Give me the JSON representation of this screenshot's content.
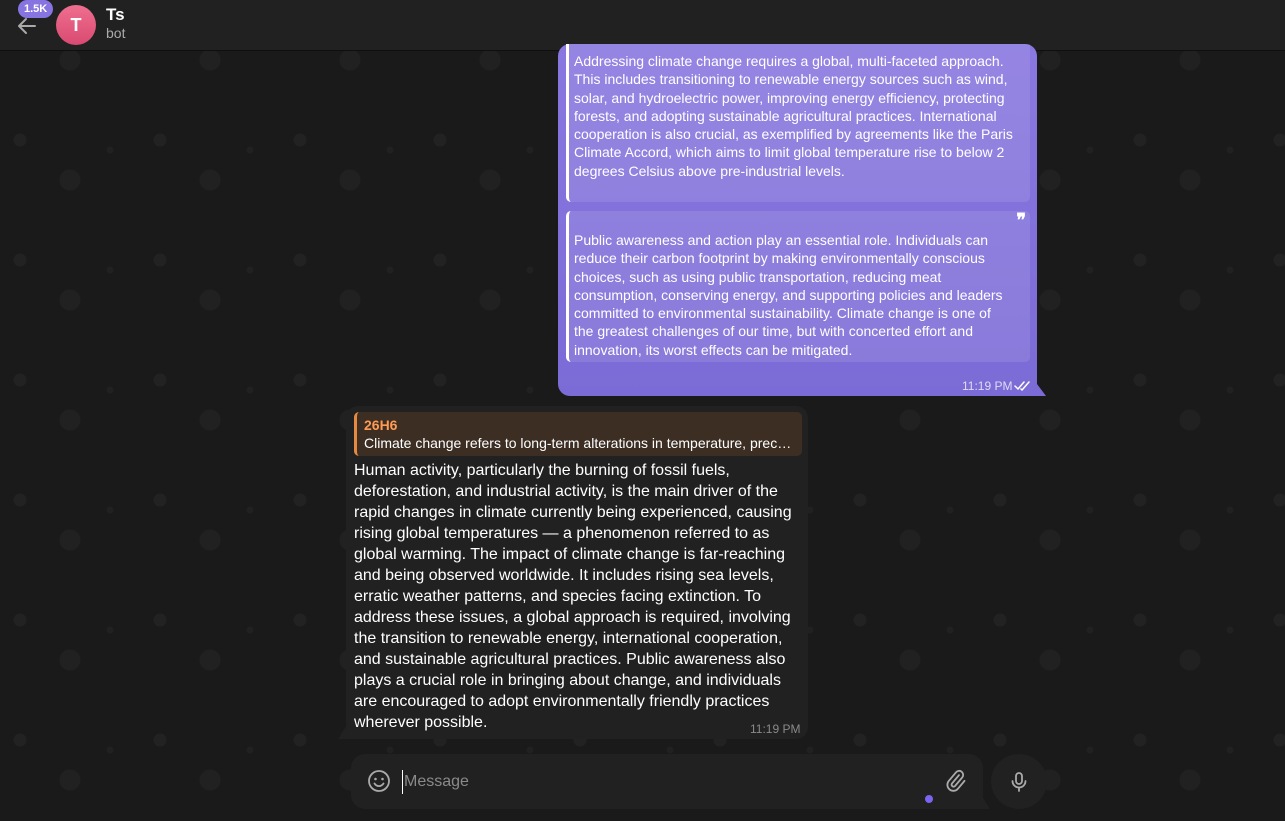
{
  "header": {
    "unread_badge": "1.5K",
    "avatar_letter": "T",
    "title": "Ts",
    "subtitle": "bot"
  },
  "outgoing": {
    "quote1": "Addressing climate change requires a global, multi-faceted approach. This includes transitioning to renewable energy sources such as wind, solar, and hydroelectric power, improving energy efficiency, protecting forests, and adopting sustainable agricultural practices. International cooperation is also crucial, as exemplified by agreements like the Paris Climate Accord, which aims to limit global temperature rise to below 2 degrees Celsius above pre-industrial levels.",
    "quote2": "Public awareness and action play an essential role. Individuals can reduce their carbon footprint by making environmentally conscious choices, such as using public transportation, reducing meat consumption, conserving energy, and supporting policies and leaders committed to environmental sustainability. Climate change is one of the greatest challenges of our time, but with concerted effort and innovation, its worst effects can be mitigated.",
    "time": "11:19 PM"
  },
  "incoming": {
    "reply_name": "26H6",
    "reply_text": "Climate change refers to long-term alterations in temperature, precipitation, wind patterns and other aspects of the Earth's climate system.",
    "text": "Human activity, particularly the burning of fossil fuels, deforestation, and industrial activity, is the main driver of the rapid changes in climate currently being experienced, causing rising global temperatures — a phenomenon referred to as global warming. The impact of climate change is far-reaching and being observed worldwide. It includes rising sea levels, erratic weather patterns, and species facing extinction. To address these issues, a global approach is required, involving the transition to renewable energy, international cooperation, and sustainable agricultural practices. Public awareness also plays a crucial role in bringing about change, and individuals are encouraged to adopt environmentally friendly practices wherever possible.",
    "time": "11:19 PM"
  },
  "composer": {
    "placeholder": "Message"
  },
  "icons": [
    "back-arrow-icon",
    "quote-icon",
    "double-check-icon",
    "smile-icon",
    "paperclip-icon",
    "microphone-icon"
  ],
  "colors": {
    "accent": "#8774e1",
    "reply_accent": "#e68a42",
    "avatar": "#e05a80"
  }
}
